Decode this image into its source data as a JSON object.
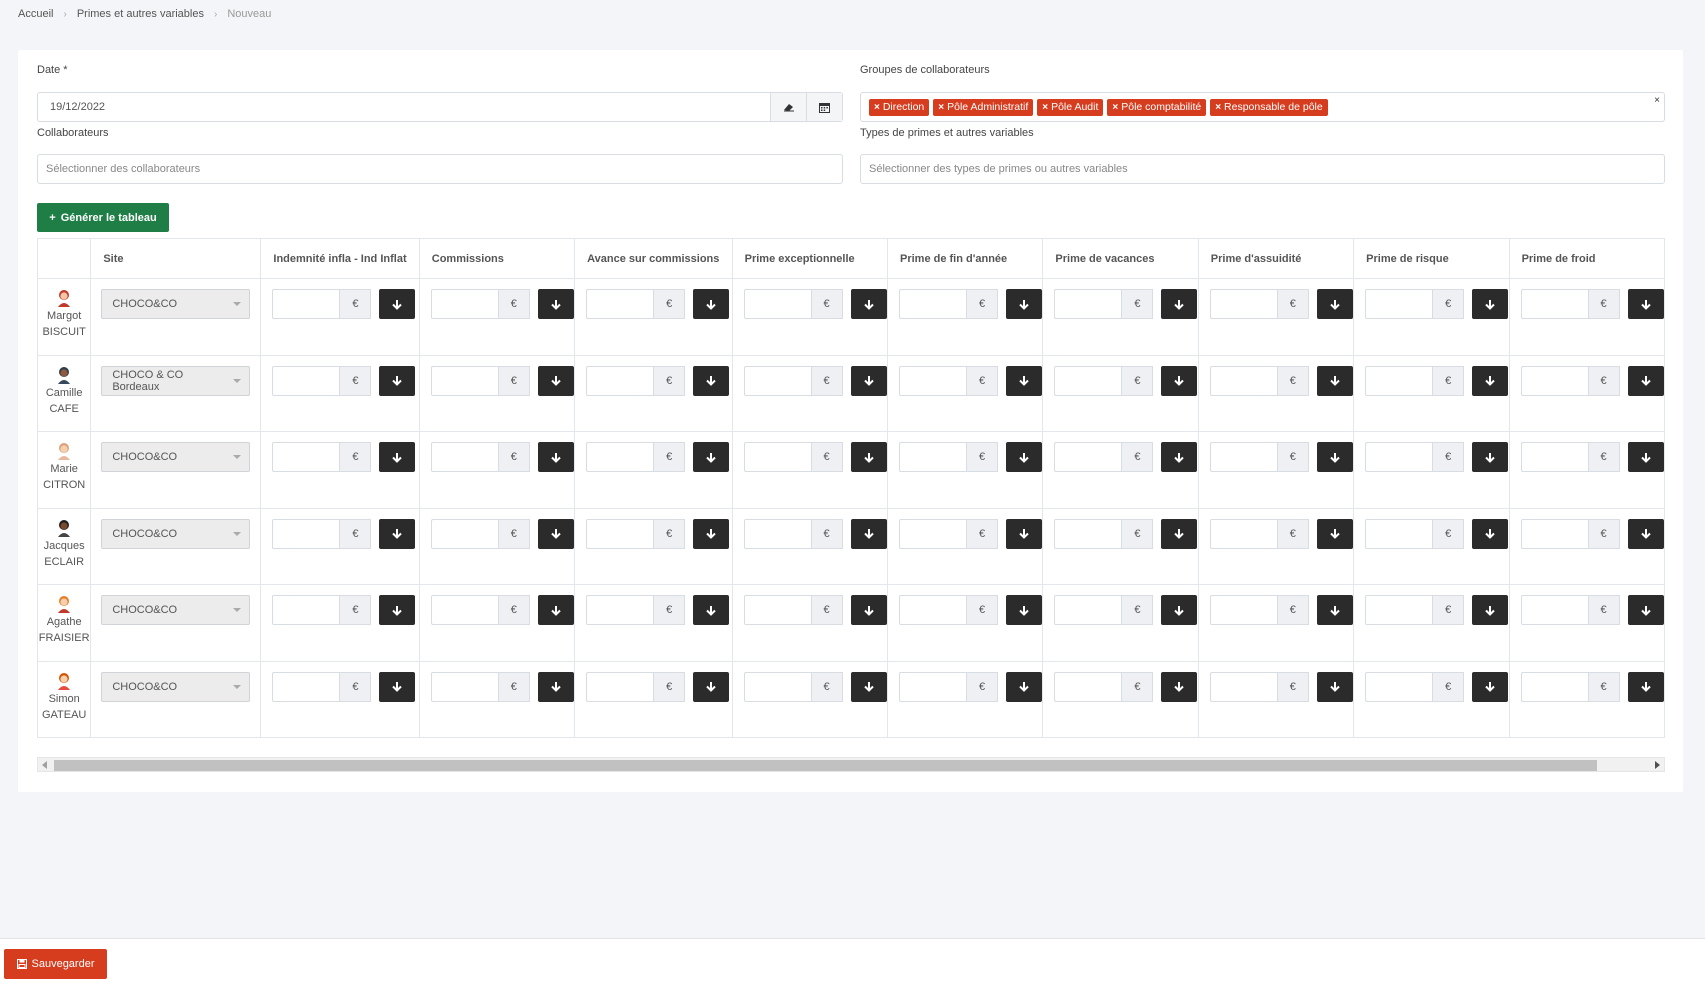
{
  "breadcrumb": [
    {
      "label": "Accueil"
    },
    {
      "label": "Primes et autres variables"
    },
    {
      "label": "Nouveau"
    }
  ],
  "form": {
    "date_label": "Date *",
    "date_value": "19/12/2022",
    "groups_label": "Groupes de collaborateurs",
    "groups": [
      "Direction",
      "Pôle Administratif",
      "Pôle Audit",
      "Pôle comptabilité",
      "Responsable de pôle"
    ],
    "collab_label": "Collaborateurs",
    "collab_placeholder": "Sélectionner des collaborateurs",
    "types_label": "Types de primes et autres variables",
    "types_placeholder": "Sélectionner des types de primes ou autres variables",
    "generate_label": "Générer le tableau",
    "clear_symbol": "×"
  },
  "table": {
    "site_header": "Site",
    "columns": [
      "Indemnité infla - Ind Inflat",
      "Commissions",
      "Avance sur commissions",
      "Prime exceptionnelle",
      "Prime de fin d'année",
      "Prime de vacances",
      "Prime d'assuidité",
      "Prime de risque",
      "Prime de froid"
    ],
    "currency": "€",
    "rows": [
      {
        "first": "Margot",
        "last": "BISCUIT",
        "site": "CHOCO&CO",
        "hair": "#c0392b",
        "skin": "#f3c7a6",
        "shirt": "#c0392b"
      },
      {
        "first": "Camille",
        "last": "CAFE",
        "site": "CHOCO & CO Bordeaux",
        "hair": "#2c3e50",
        "skin": "#8d5a3b",
        "shirt": "#34495e"
      },
      {
        "first": "Marie",
        "last": "CITRON",
        "site": "CHOCO&CO",
        "hair": "#d9a27a",
        "skin": "#f5cfb0",
        "shirt": "#e8b8a0"
      },
      {
        "first": "Jacques",
        "last": "ECLAIR",
        "site": "CHOCO&CO",
        "hair": "#1f1f1f",
        "skin": "#7a4a2b",
        "shirt": "#444444"
      },
      {
        "first": "Agathe",
        "last": "FRAISIER",
        "site": "CHOCO&CO",
        "hair": "#e67e22",
        "skin": "#f5cfb0",
        "shirt": "#c0392b"
      },
      {
        "first": "Simon",
        "last": "GATEAU",
        "site": "CHOCO&CO",
        "hair": "#d35400",
        "skin": "#f5cfb0",
        "shirt": "#e74c3c"
      }
    ]
  },
  "footer": {
    "save_label": "Sauvegarder"
  },
  "colors": {
    "accent_red": "#d63c1e",
    "accent_green": "#1e7e45",
    "dark_button": "#2b2b2b"
  }
}
